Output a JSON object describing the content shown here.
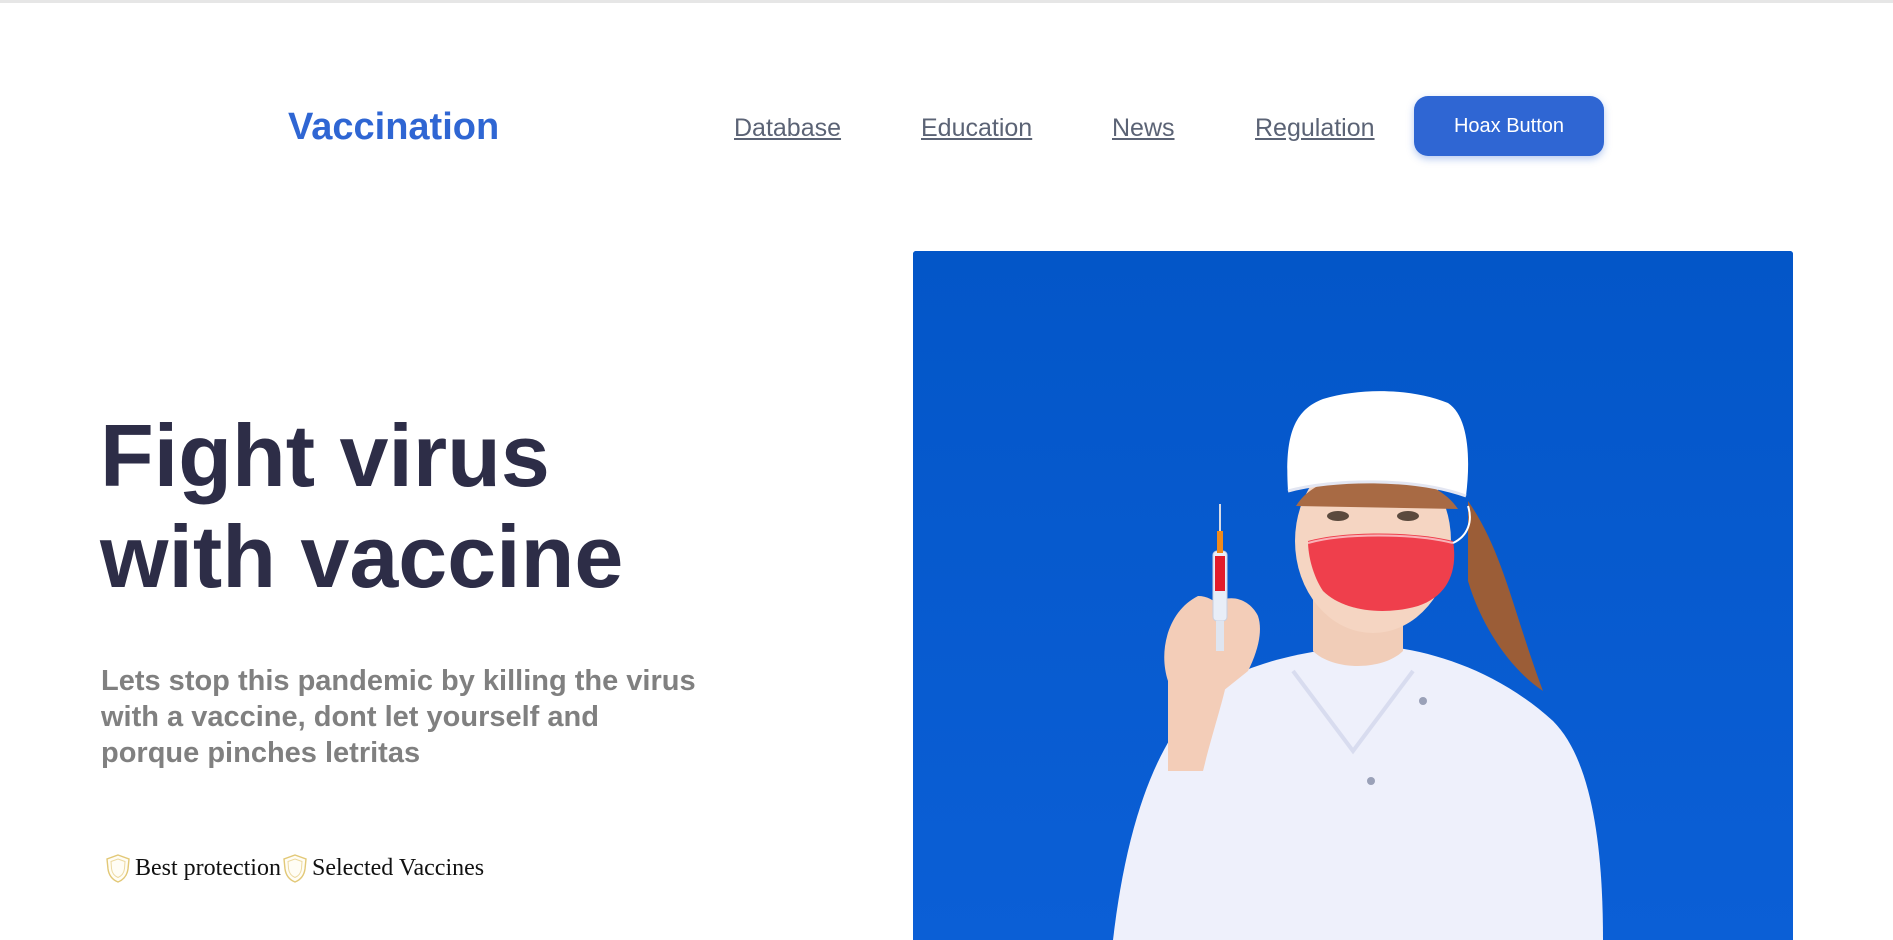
{
  "header": {
    "brand": "Vaccination",
    "nav": [
      {
        "label": "Database"
      },
      {
        "label": "Education"
      },
      {
        "label": "News"
      },
      {
        "label": "Regulation"
      }
    ],
    "cta_label": "Hoax Button"
  },
  "hero": {
    "title_lines": [
      "Fight virus",
      "with vaccine"
    ],
    "subtitle_lines": [
      "Lets stop this pandemic by killing the virus",
      "with a vaccine, dont let yourself and",
      "porque pinches letritas"
    ],
    "features": [
      {
        "icon": "shield-icon",
        "label": "Best protection"
      },
      {
        "icon": "shield-icon",
        "label": "Selected Vaccines"
      }
    ]
  },
  "colors": {
    "accent": "#2f66d3",
    "title": "#2d2d47",
    "subtitle": "#808080",
    "nav": "#5b6375",
    "image_background": "#0058cc",
    "shield": "#e2c877"
  }
}
